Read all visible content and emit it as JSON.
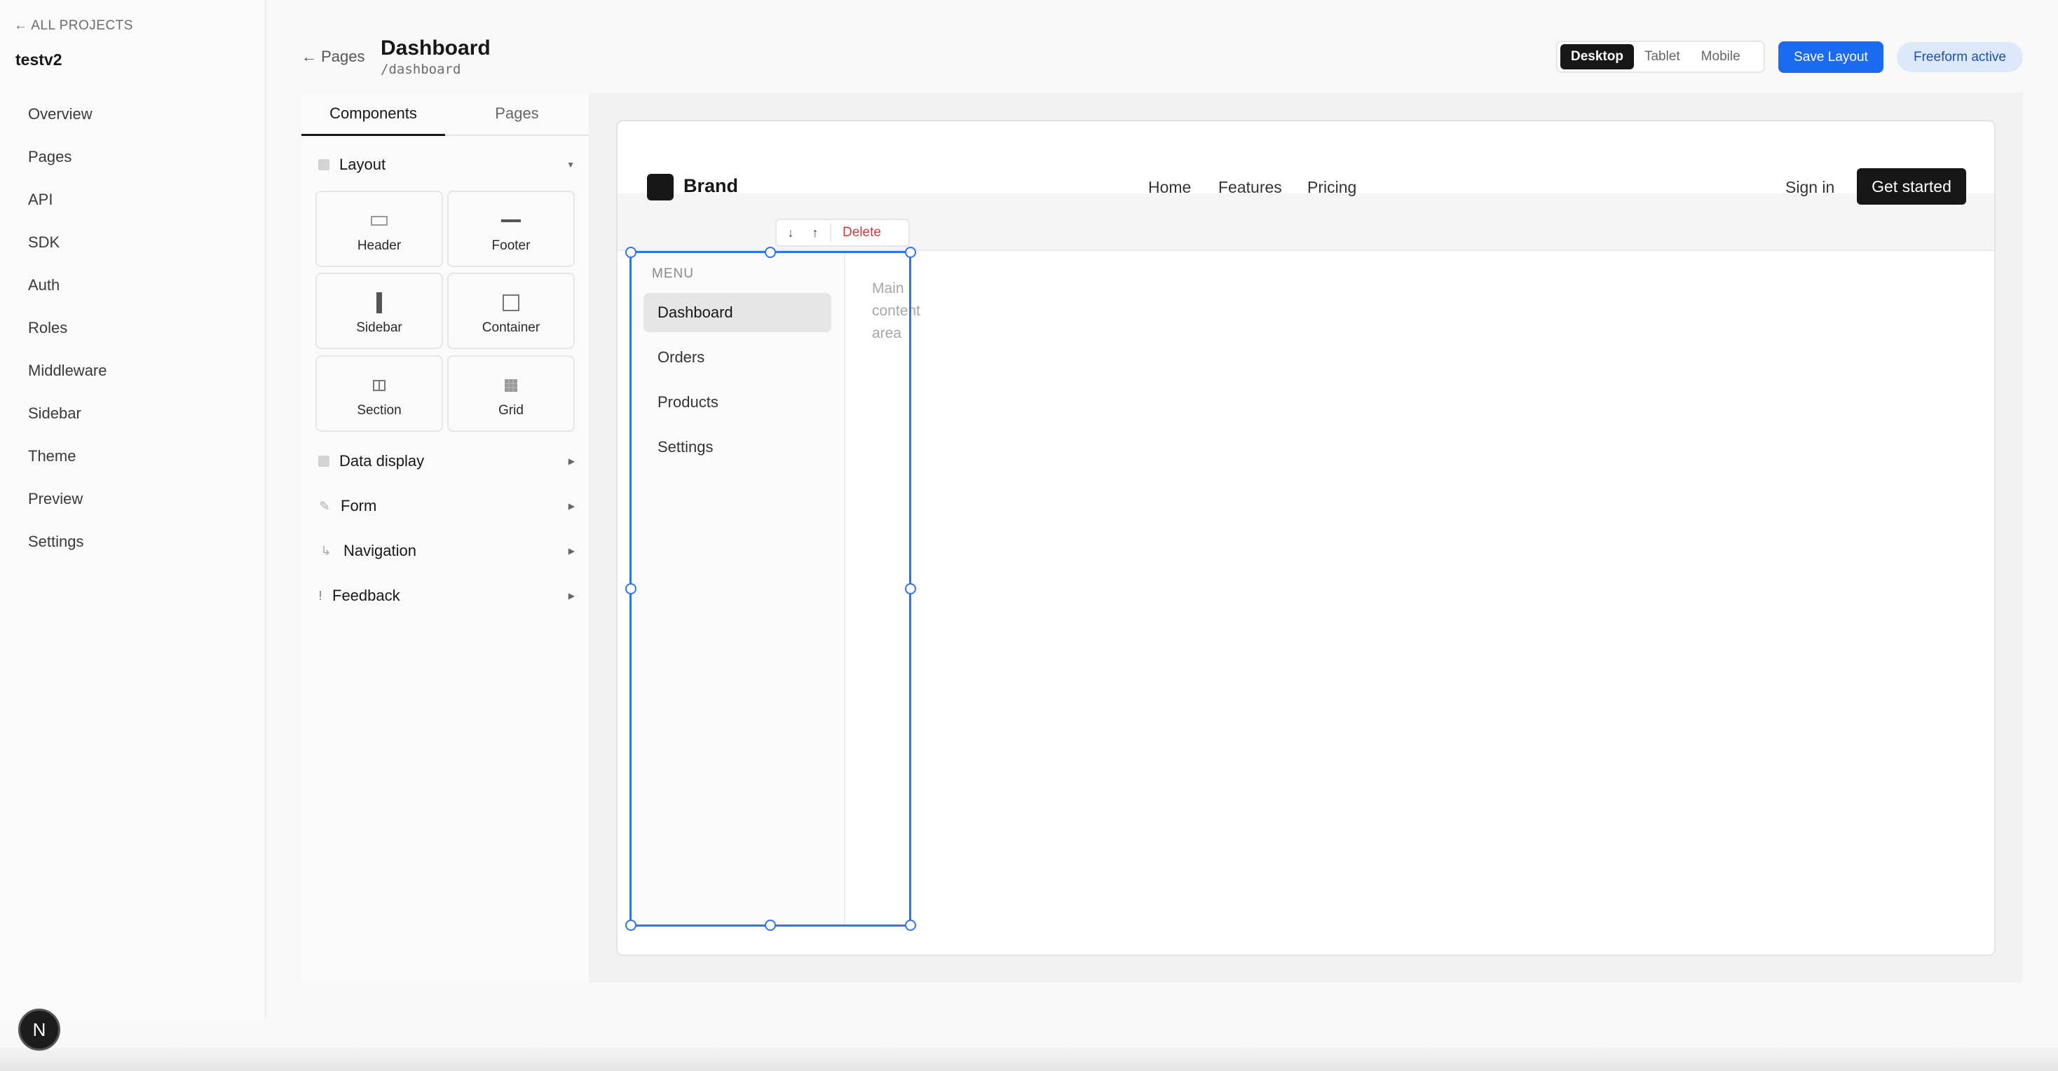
{
  "project_sidebar": {
    "back_label": "← ALL PROJECTS",
    "project_name": "testv2",
    "items": [
      {
        "label": "Overview"
      },
      {
        "label": "Pages"
      },
      {
        "label": "API"
      },
      {
        "label": "SDK"
      },
      {
        "label": "Auth"
      },
      {
        "label": "Roles"
      },
      {
        "label": "Middleware"
      },
      {
        "label": "Sidebar"
      },
      {
        "label": "Theme"
      },
      {
        "label": "Preview"
      },
      {
        "label": "Settings"
      }
    ]
  },
  "header": {
    "back_label": "← Pages",
    "title": "Dashboard",
    "route": "/dashboard",
    "device_options": [
      "Desktop",
      "Tablet",
      "Mobile"
    ],
    "selected_device": "Desktop",
    "save_label": "Save Layout",
    "mode_badge": "Freeform active"
  },
  "component_panel": {
    "tabs": [
      "Components",
      "Pages"
    ],
    "active_tab": "Components",
    "categories": [
      {
        "label": "Layout",
        "expanded": true,
        "icon": "square-icon"
      },
      {
        "label": "Data display",
        "expanded": false,
        "icon": "square-icon"
      },
      {
        "label": "Form",
        "expanded": false,
        "icon": "pencil-icon"
      },
      {
        "label": "Navigation",
        "expanded": false,
        "icon": "corner-arrow-icon"
      },
      {
        "label": "Feedback",
        "expanded": false,
        "icon": "exclamation-icon"
      }
    ],
    "layout_components": [
      {
        "label": "Header",
        "icon": "header-icon"
      },
      {
        "label": "Footer",
        "icon": "footer-icon"
      },
      {
        "label": "Sidebar",
        "icon": "sidebar-icon"
      },
      {
        "label": "Container",
        "icon": "container-icon"
      },
      {
        "label": "Section",
        "icon": "section-icon"
      },
      {
        "label": "Grid",
        "icon": "grid-icon"
      }
    ]
  },
  "canvas": {
    "site_nav": {
      "brand": "Brand",
      "links": [
        "Home",
        "Features",
        "Pricing"
      ],
      "signin": "Sign in",
      "cta": "Get started"
    },
    "sidebar": {
      "menu_label": "MENU",
      "items": [
        "Dashboard",
        "Orders",
        "Products",
        "Settings"
      ],
      "active_item": "Dashboard"
    },
    "main_placeholder": "Main content area",
    "selection_toolbar": {
      "move_down_icon": "arrow-down-icon",
      "move_up_icon": "arrow-up-icon",
      "delete_label": "Delete"
    }
  },
  "avatar_initial": "N",
  "colors": {
    "accent": "#1a6bf0",
    "selection": "#2f73ee",
    "danger": "#e0323b",
    "dark": "#171717"
  }
}
